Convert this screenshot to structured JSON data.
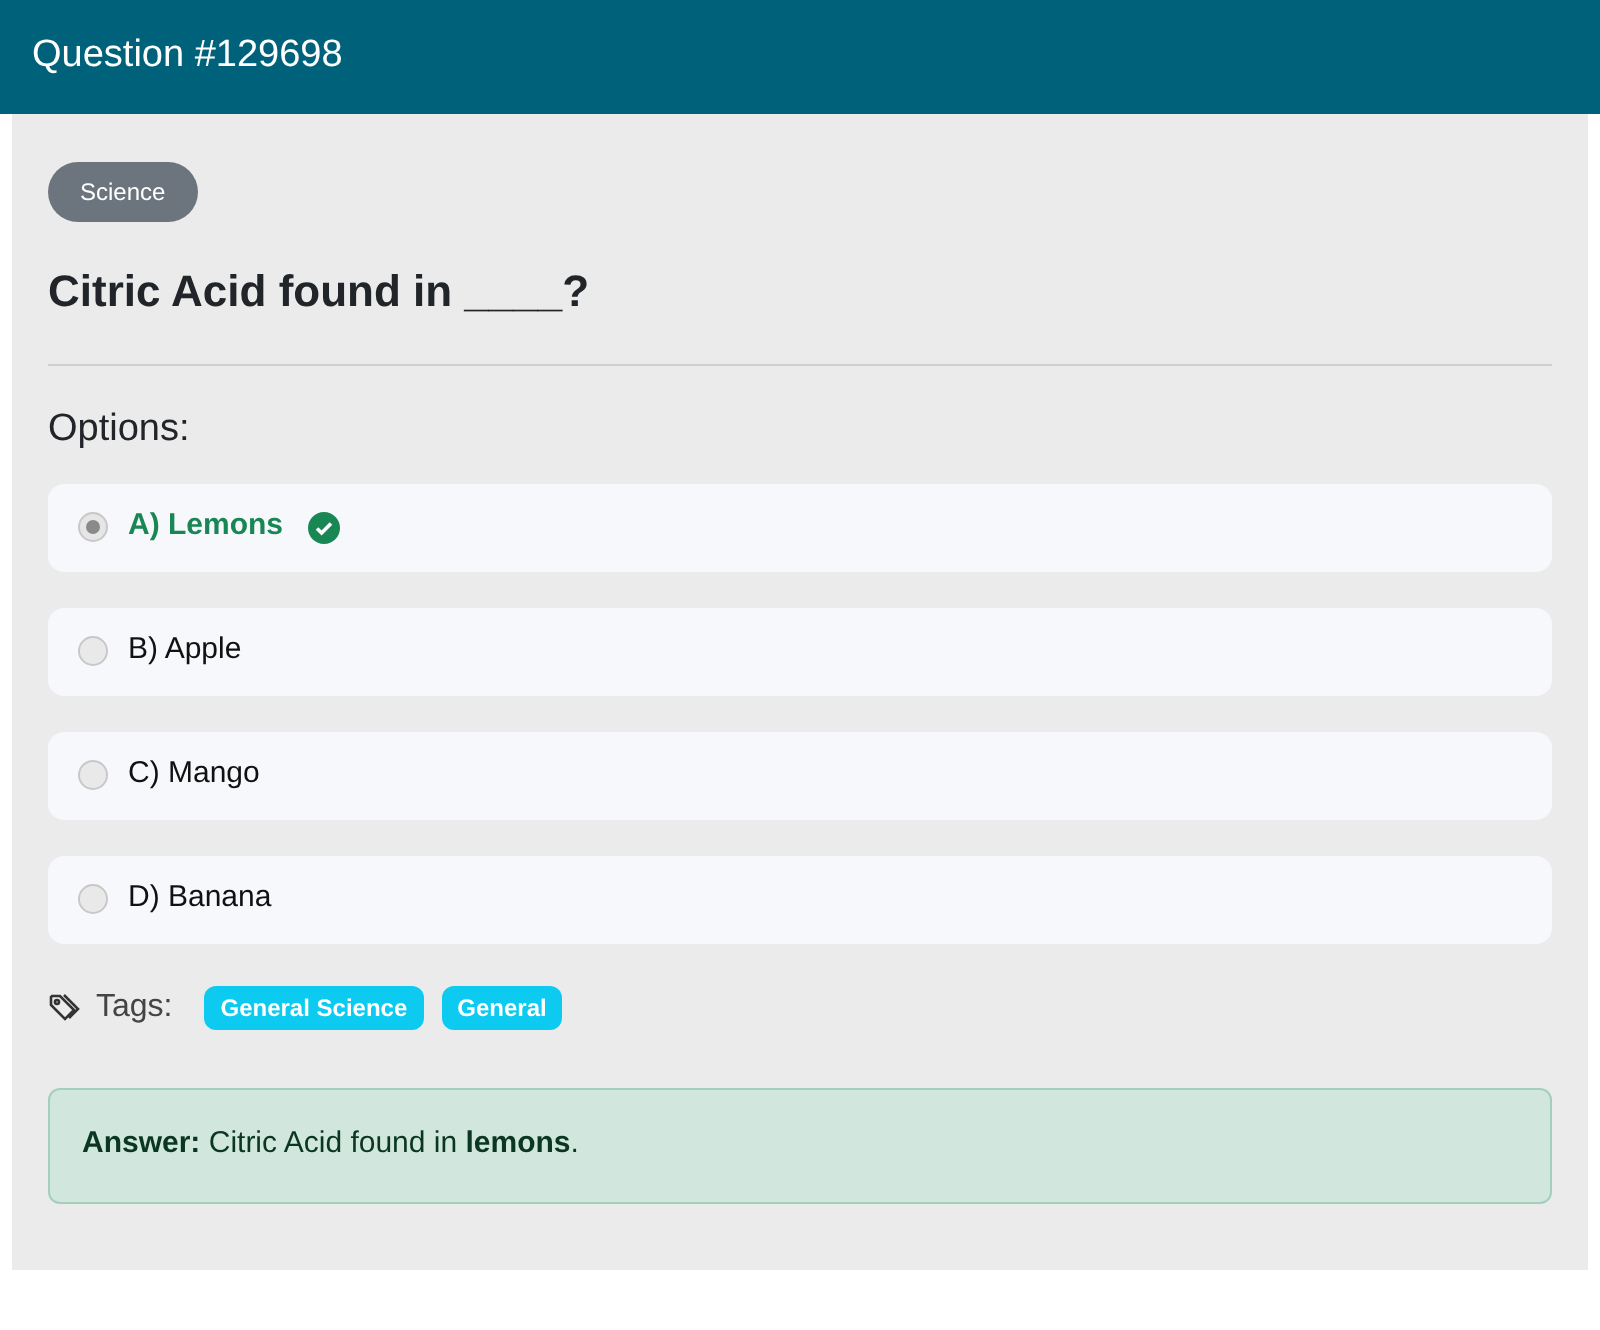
{
  "header": {
    "title": "Question #129698"
  },
  "category": "Science",
  "question": "Citric Acid found in ____?",
  "options_label": "Options:",
  "options": [
    {
      "label": "A) Lemons",
      "selected": true,
      "correct": true
    },
    {
      "label": "B) Apple",
      "selected": false,
      "correct": false
    },
    {
      "label": "C) Mango",
      "selected": false,
      "correct": false
    },
    {
      "label": "D) Banana",
      "selected": false,
      "correct": false
    }
  ],
  "tags_label": "Tags:",
  "tags": [
    "General Science",
    "General"
  ],
  "answer": "**Answer:** Citric Acid found in **lemons**."
}
